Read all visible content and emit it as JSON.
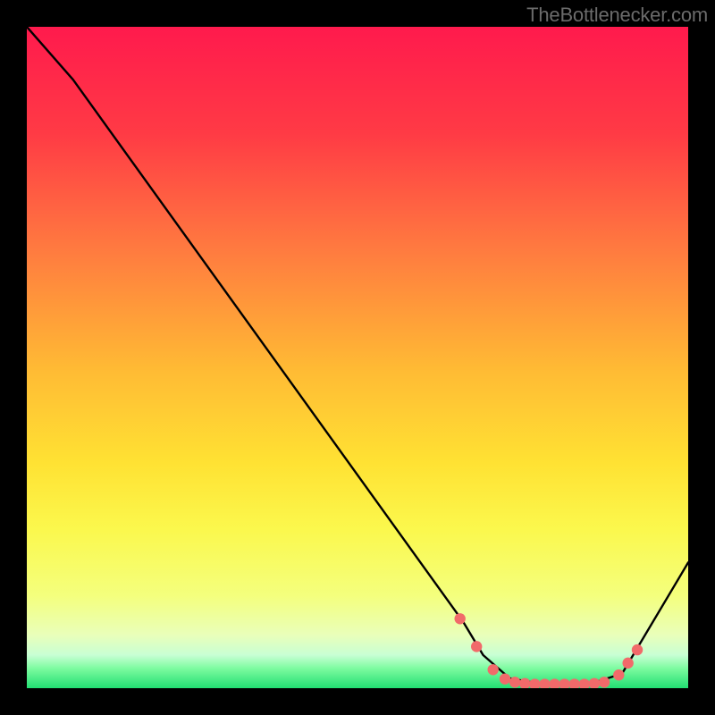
{
  "watermark": "TheBottlenecker.com",
  "chart_data": {
    "type": "line",
    "title": "",
    "xlabel": "",
    "ylabel": "",
    "xlim": [
      0,
      100
    ],
    "ylim": [
      0,
      100
    ],
    "grid": false,
    "gradient_stops": [
      {
        "offset": 0,
        "color": "#ff1a4d"
      },
      {
        "offset": 16,
        "color": "#ff3a45"
      },
      {
        "offset": 33,
        "color": "#ff7840"
      },
      {
        "offset": 52,
        "color": "#ffbb34"
      },
      {
        "offset": 66,
        "color": "#ffe233"
      },
      {
        "offset": 76,
        "color": "#fbf84d"
      },
      {
        "offset": 86,
        "color": "#f4ff7d"
      },
      {
        "offset": 92,
        "color": "#e9ffba"
      },
      {
        "offset": 95,
        "color": "#c8ffd4"
      },
      {
        "offset": 97,
        "color": "#7dfba0"
      },
      {
        "offset": 100,
        "color": "#22df72"
      }
    ],
    "series": [
      {
        "name": "bottleneck-curve",
        "color": "#000000",
        "stroke_width": 2.4,
        "points": [
          {
            "x": 0,
            "y": 100
          },
          {
            "x": 7,
            "y": 92
          },
          {
            "x": 66,
            "y": 10
          },
          {
            "x": 69,
            "y": 5
          },
          {
            "x": 73,
            "y": 1.5
          },
          {
            "x": 78,
            "y": 0.6
          },
          {
            "x": 85,
            "y": 0.6
          },
          {
            "x": 90,
            "y": 2.2
          },
          {
            "x": 100,
            "y": 19
          }
        ]
      }
    ],
    "markers": {
      "color": "#f16a6a",
      "radius": 6.2,
      "points": [
        {
          "x": 65.5,
          "y": 10.5
        },
        {
          "x": 68.0,
          "y": 6.3
        },
        {
          "x": 70.5,
          "y": 2.8
        },
        {
          "x": 72.3,
          "y": 1.4
        },
        {
          "x": 73.8,
          "y": 0.9
        },
        {
          "x": 75.3,
          "y": 0.7
        },
        {
          "x": 76.8,
          "y": 0.6
        },
        {
          "x": 78.3,
          "y": 0.6
        },
        {
          "x": 79.8,
          "y": 0.6
        },
        {
          "x": 81.3,
          "y": 0.6
        },
        {
          "x": 82.8,
          "y": 0.6
        },
        {
          "x": 84.3,
          "y": 0.6
        },
        {
          "x": 85.8,
          "y": 0.7
        },
        {
          "x": 87.3,
          "y": 0.9
        },
        {
          "x": 89.5,
          "y": 2.0
        },
        {
          "x": 90.9,
          "y": 3.8
        },
        {
          "x": 92.3,
          "y": 5.8
        }
      ]
    }
  }
}
